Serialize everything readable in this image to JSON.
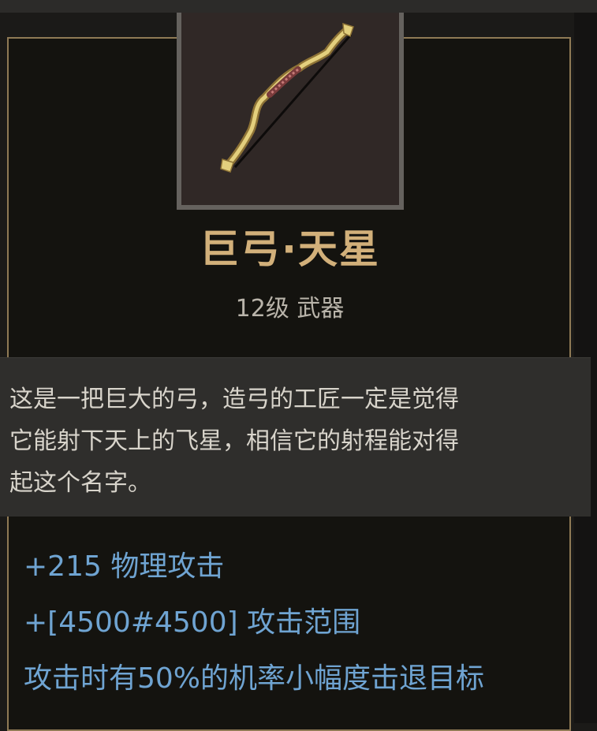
{
  "item": {
    "icon": "great-bow-icon",
    "name": "巨弓·天星",
    "meta": "12级 武器"
  },
  "description": {
    "lines": [
      "这是一把巨大的弓，造弓的工匠一定是觉得",
      "它能射下天上的飞星，相信它的射程能对得",
      "起这个名字。"
    ]
  },
  "stats": [
    "+215 物理攻击",
    "+[4500#4500] 攻击范围",
    "攻击时有50%的机率小幅度击退目标"
  ],
  "colors": {
    "name": "#d2b07a",
    "stat": "#6fa4d2",
    "frame_border": "#8f7a55",
    "panel": "#14130f",
    "description_bg": "#2f2e2c"
  }
}
